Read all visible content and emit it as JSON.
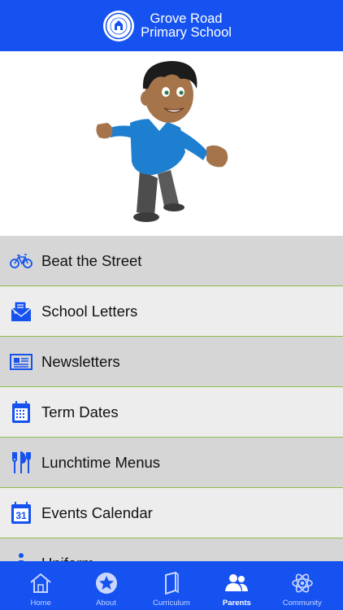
{
  "header": {
    "title_line1": "Grove Road",
    "title_line2": "Primary School"
  },
  "colors": {
    "brand_blue": "#1552f0",
    "row_dark": "#d6d6d6",
    "row_light": "#ededed",
    "divider_green": "#8fbf4a"
  },
  "menu": {
    "items": [
      {
        "label": "Beat the Street",
        "icon": "bicycle-icon"
      },
      {
        "label": "School Letters",
        "icon": "envelope-icon"
      },
      {
        "label": "Newsletters",
        "icon": "newspaper-icon"
      },
      {
        "label": "Term Dates",
        "icon": "calendar-grid-icon"
      },
      {
        "label": "Lunchtime Menus",
        "icon": "cutlery-icon"
      },
      {
        "label": "Events Calendar",
        "icon": "calendar-31-icon"
      },
      {
        "label": "Uniform",
        "icon": "info-icon"
      }
    ]
  },
  "calendar_icon_number": "31",
  "tabbar": {
    "tabs": [
      {
        "label": "Home",
        "icon": "home-icon"
      },
      {
        "label": "About",
        "icon": "star-icon"
      },
      {
        "label": "Curriculum",
        "icon": "book-icon"
      },
      {
        "label": "Parents",
        "icon": "people-icon",
        "active": true
      },
      {
        "label": "Community",
        "icon": "atom-icon"
      }
    ]
  }
}
